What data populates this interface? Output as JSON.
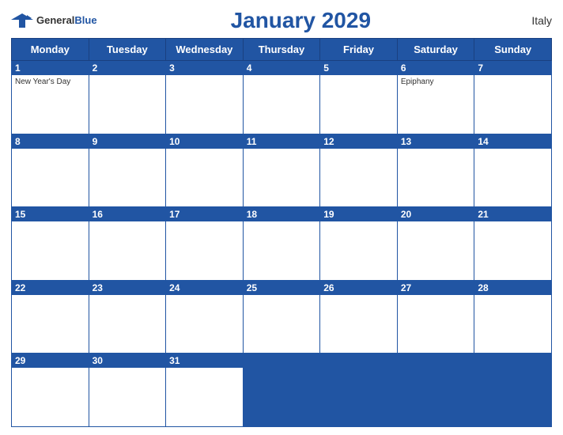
{
  "header": {
    "logo_general": "General",
    "logo_blue": "Blue",
    "title": "January 2029",
    "country": "Italy"
  },
  "days_of_week": [
    "Monday",
    "Tuesday",
    "Wednesday",
    "Thursday",
    "Friday",
    "Saturday",
    "Sunday"
  ],
  "weeks": [
    [
      {
        "day": 1,
        "holiday": "New Year's Day"
      },
      {
        "day": 2,
        "holiday": ""
      },
      {
        "day": 3,
        "holiday": ""
      },
      {
        "day": 4,
        "holiday": ""
      },
      {
        "day": 5,
        "holiday": ""
      },
      {
        "day": 6,
        "holiday": "Epiphany"
      },
      {
        "day": 7,
        "holiday": ""
      }
    ],
    [
      {
        "day": 8,
        "holiday": ""
      },
      {
        "day": 9,
        "holiday": ""
      },
      {
        "day": 10,
        "holiday": ""
      },
      {
        "day": 11,
        "holiday": ""
      },
      {
        "day": 12,
        "holiday": ""
      },
      {
        "day": 13,
        "holiday": ""
      },
      {
        "day": 14,
        "holiday": ""
      }
    ],
    [
      {
        "day": 15,
        "holiday": ""
      },
      {
        "day": 16,
        "holiday": ""
      },
      {
        "day": 17,
        "holiday": ""
      },
      {
        "day": 18,
        "holiday": ""
      },
      {
        "day": 19,
        "holiday": ""
      },
      {
        "day": 20,
        "holiday": ""
      },
      {
        "day": 21,
        "holiday": ""
      }
    ],
    [
      {
        "day": 22,
        "holiday": ""
      },
      {
        "day": 23,
        "holiday": ""
      },
      {
        "day": 24,
        "holiday": ""
      },
      {
        "day": 25,
        "holiday": ""
      },
      {
        "day": 26,
        "holiday": ""
      },
      {
        "day": 27,
        "holiday": ""
      },
      {
        "day": 28,
        "holiday": ""
      }
    ],
    [
      {
        "day": 29,
        "holiday": ""
      },
      {
        "day": 30,
        "holiday": ""
      },
      {
        "day": 31,
        "holiday": ""
      },
      {
        "day": null,
        "holiday": ""
      },
      {
        "day": null,
        "holiday": ""
      },
      {
        "day": null,
        "holiday": ""
      },
      {
        "day": null,
        "holiday": ""
      }
    ]
  ]
}
